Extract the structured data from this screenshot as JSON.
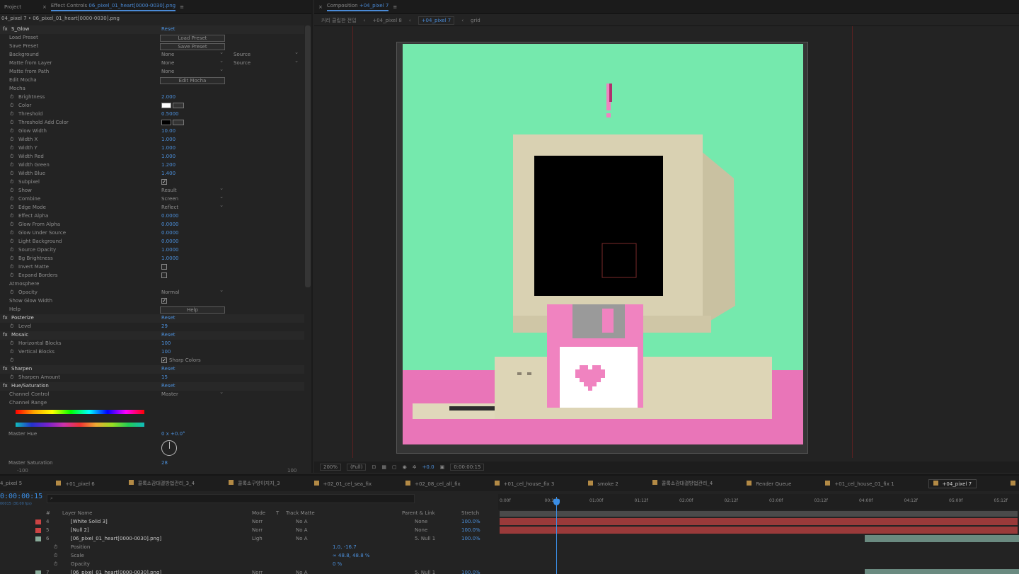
{
  "ec": {
    "tabs": {
      "project": "Project",
      "fx_controls_label": "Effect Controls",
      "fx_controls_file": "06_pixel_01_heart[0000-0030].png"
    },
    "subtitle": "04_pixel 7 • 06_pixel_01_heart[0000-0030].png",
    "rows": [
      {
        "label": "S_Glow",
        "fx": true,
        "val": "Reset"
      },
      {
        "label": "Load Preset",
        "btn": "Load Preset",
        "ind": 1
      },
      {
        "label": "Save Preset",
        "btn": "Save Preset",
        "ind": 1
      },
      {
        "label": "Background",
        "drop": "None",
        "drop2": "Source",
        "ind": 1
      },
      {
        "label": "Matte from Layer",
        "drop": "None",
        "drop2": "Source",
        "ind": 1
      },
      {
        "label": "Matte from Path",
        "drop": "None",
        "ind": 1
      },
      {
        "label": "Edit Mocha",
        "btn": "Edit Mocha",
        "ind": 1
      },
      {
        "label": "Mocha",
        "ind": 1
      },
      {
        "label": "Brightness",
        "val": "2.000",
        "ind": 2
      },
      {
        "label": "Color",
        "swatch": "#ffffff",
        "ind": 2
      },
      {
        "label": "Threshold",
        "val": "0.5000",
        "ind": 2
      },
      {
        "label": "Threshold Add Color",
        "swatch": "#000000",
        "ind": 2
      },
      {
        "label": "Glow Width",
        "val": "10.00",
        "ind": 2
      },
      {
        "label": "Width X",
        "val": "1.000",
        "ind": 2
      },
      {
        "label": "Width Y",
        "val": "1.000",
        "ind": 2
      },
      {
        "label": "Width Red",
        "val": "1.000",
        "ind": 2
      },
      {
        "label": "Width Green",
        "val": "1.200",
        "ind": 2
      },
      {
        "label": "Width Blue",
        "val": "1.400",
        "ind": 2
      },
      {
        "label": "Subpixel",
        "check": true,
        "ind": 2
      },
      {
        "label": "Show",
        "drop": "Result",
        "ind": 2
      },
      {
        "label": "Combine",
        "drop": "Screen",
        "ind": 2
      },
      {
        "label": "Edge Mode",
        "drop": "Reflect",
        "ind": 2
      },
      {
        "label": "Effect Alpha",
        "val": "0.0000",
        "ind": 2
      },
      {
        "label": "Glow From Alpha",
        "val": "0.0000",
        "ind": 2
      },
      {
        "label": "Glow Under Source",
        "val": "0.0000",
        "ind": 2
      },
      {
        "label": "Light Background",
        "val": "0.0000",
        "ind": 2
      },
      {
        "label": "Source Opacity",
        "val": "1.0000",
        "ind": 2
      },
      {
        "label": "Bg Brightness",
        "val": "1.0000",
        "ind": 2
      },
      {
        "label": "Invert Matte",
        "check": false,
        "ind": 2
      },
      {
        "label": "Expand Borders",
        "check": false,
        "ind": 2
      },
      {
        "label": "Atmosphere",
        "ind": 1
      },
      {
        "label": "Opacity",
        "drop": "Normal",
        "ind": 2
      },
      {
        "label": "Show Glow Width",
        "check": true,
        "ind": 1
      },
      {
        "label": "Help",
        "btn": "Help",
        "ind": 1
      },
      {
        "label": "Posterize",
        "fx": true,
        "val": "Reset"
      },
      {
        "label": "Level",
        "val": "29",
        "ind": 2
      },
      {
        "label": "Mosaic",
        "fx": true,
        "val": "Reset"
      },
      {
        "label": "Horizontal Blocks",
        "val": "100",
        "ind": 2
      },
      {
        "label": "Vertical Blocks",
        "val": "100",
        "ind": 2
      },
      {
        "label": "",
        "check": true,
        "checklabel": "Sharp Colors",
        "ind": 2
      },
      {
        "label": "Sharpen",
        "fx": true,
        "val": "Reset"
      },
      {
        "label": "Sharpen Amount",
        "val": "15",
        "ind": 2
      },
      {
        "label": "Hue/Saturation",
        "fx": true,
        "val": "Reset"
      },
      {
        "label": "Channel Control",
        "drop": "Master",
        "ind": 1
      },
      {
        "label": "Channel Range",
        "ind": 1
      }
    ],
    "master_hue": {
      "label": "Master Hue",
      "val": "0 x +0.0°"
    },
    "master_sat": {
      "label": "Master Saturation",
      "val": "28"
    },
    "sat_min": "-100",
    "sat_max": "100"
  },
  "comp": {
    "tab_label": "Composition",
    "tab_name": "+04_pixel 7",
    "crumbs": [
      "커리 클립판 전입",
      "+04_pixel 8",
      "+04_pixel 7",
      "grid"
    ],
    "active_crumb_index": 2,
    "zoom": "200%",
    "resolution": "(Full)",
    "timecode": "0:00:00:15",
    "exposure": "+0.0",
    "colors": {
      "sky": "#75e9ad",
      "floor": "#e975b8",
      "beige": "#d9d1b2",
      "disk": "#f083c0"
    }
  },
  "timeline": {
    "tabs": [
      "4_pixel 5",
      "+01_pixel 6",
      "콜록소감대결방법관리_3_4",
      "콜록소구양이지지_3",
      "+02_01_cel_sea_fix",
      "+02_08_cel_all_fix",
      "+01_cel_house_fix 3",
      "smoke 2",
      "콜록소감대결방법관리_4",
      "Render Queue",
      "+01_cel_house_01_fix 1",
      "+04_pixel 7",
      "grid"
    ],
    "active_tab_index": 11,
    "timecode": "0:00:00:15",
    "timecode_sub": "00015 (30.00 fps)",
    "headers": {
      "num": "#",
      "name": "Layer Name",
      "mode": "Mode",
      "t": "T",
      "trkmat": "Track Matte",
      "parent": "Parent & Link",
      "stretch": "Stretch"
    },
    "ruler": [
      "0:00f",
      "00:12f",
      "01:00f",
      "01:12f",
      "02:00f",
      "02:12f",
      "03:00f",
      "03:12f",
      "04:00f",
      "04:12f",
      "05:00f",
      "05:12f"
    ],
    "layers": [
      {
        "num": "4",
        "name": "[White Solid 3]",
        "mode": "Norr",
        "trk": "No A",
        "parent": "None",
        "stretch": "100.0%",
        "color": "#c44"
      },
      {
        "num": "5",
        "name": "[Null 2]",
        "mode": "Norr",
        "trk": "No A",
        "parent": "None",
        "stretch": "100.0%",
        "color": "#c44"
      },
      {
        "num": "6",
        "name": "[06_pixel_01_heart[0000-0030].png]",
        "mode": "Ligh",
        "trk": "No A",
        "parent": "5. Null 1",
        "stretch": "100.0%",
        "color": "#8a9"
      },
      {
        "prop": "Position",
        "val": "1.0, -16.7"
      },
      {
        "prop": "Scale",
        "val": "∞ 48.8, 48.8 %"
      },
      {
        "prop": "Opacity",
        "val": "0 %"
      },
      {
        "num": "7",
        "name": "[06_pixel_01_heart[0000-0030].png]",
        "mode": "Norr",
        "trk": "No A",
        "parent": "5. Null 1",
        "stretch": "100.0%",
        "color": "#8a9"
      }
    ]
  }
}
